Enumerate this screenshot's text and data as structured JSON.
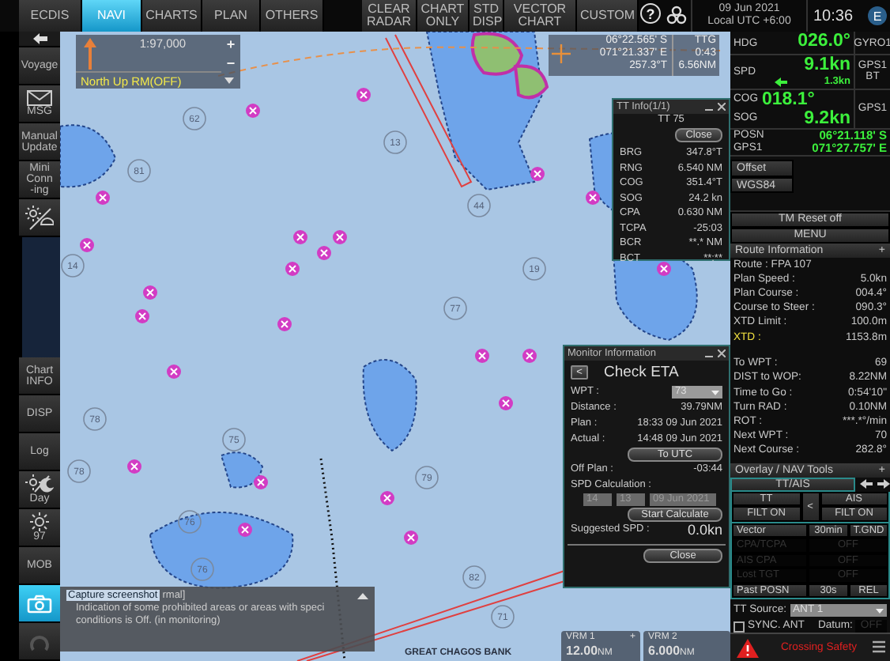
{
  "top_bar": {
    "tabs": [
      {
        "label": "ECDIS",
        "selected": false
      },
      {
        "label": "NAVI",
        "selected": true
      },
      {
        "label": "CHARTS",
        "selected": false
      },
      {
        "label": "PLAN",
        "selected": false
      },
      {
        "label": "OTHERS",
        "selected": false
      }
    ],
    "buttons": [
      "CLEAR RADAR",
      "CHART ONLY",
      "STD DISP",
      "VECTOR CHART",
      "CUSTOM"
    ],
    "help": "?",
    "date": "09 Jun 2021",
    "timezone": "Local UTC +6:00",
    "time": "10:36",
    "mode_badge": "E"
  },
  "sidebar": {
    "upper": [
      {
        "kind": "text",
        "label": "Voyage",
        "selected": false
      },
      {
        "kind": "mail",
        "label": "MSG",
        "selected": false
      },
      {
        "kind": "text",
        "label": "Manual\nUpdate",
        "selected": false
      },
      {
        "kind": "text",
        "label": "Mini\nConn\n-ing",
        "selected": false
      },
      {
        "kind": "daynight",
        "selected": false
      }
    ],
    "lower": [
      {
        "kind": "text",
        "label": "Chart\nINFO",
        "selected": false
      },
      {
        "kind": "text",
        "label": "DISP",
        "selected": false
      },
      {
        "kind": "text",
        "label": "Log",
        "selected": false
      },
      {
        "kind": "day",
        "label": "Day",
        "selected": false
      },
      {
        "kind": "brightness",
        "label": "97",
        "selected": false
      },
      {
        "kind": "text",
        "label": "MOB",
        "selected": false
      },
      {
        "kind": "camera",
        "selected": true
      },
      {
        "kind": "undo",
        "selected": false
      }
    ]
  },
  "chart": {
    "place_label": "GREAT CHAGOS BANK",
    "soundings": [
      "81",
      "13",
      "14",
      "62",
      "44",
      "78",
      "76",
      "75",
      "79",
      "77",
      "78",
      "76",
      "71",
      "19",
      "82"
    ]
  },
  "scale_box": {
    "scale": "1:97,000",
    "zoom_in": "+",
    "zoom_out": "−",
    "orientation": "North  Up RM(OFF)"
  },
  "cursor_info": {
    "lat": "06°22.565' S",
    "lon": "071°21.337' E",
    "bearing": "257.3°T",
    "ttg_label": "TTG",
    "ttg": "0:43",
    "range": "6.56NM"
  },
  "tt_info": {
    "title": "TT Info(1/1)",
    "target": "TT  75",
    "close": "Close",
    "rows": [
      {
        "label": "BRG",
        "value": "347.8°T"
      },
      {
        "label": "RNG",
        "value": "6.540 NM"
      },
      {
        "label": "COG",
        "value": "351.4°T"
      },
      {
        "label": "SOG",
        "value": "24.2 kn"
      },
      {
        "label": "CPA",
        "value": "0.630 NM"
      },
      {
        "label": "TCPA",
        "value": "-25:03"
      },
      {
        "label": "BCR",
        "value": "**.* NM"
      },
      {
        "label": "BCT",
        "value": "**:**"
      }
    ]
  },
  "monitor": {
    "title": "Monitor Information",
    "back": "<",
    "heading": "Check ETA",
    "wpt_label": "WPT :",
    "wpt": "73",
    "rows": [
      {
        "label": "Distance :",
        "value": "39.79NM"
      },
      {
        "label": "Plan :",
        "value": "18:33 09 Jun 2021"
      },
      {
        "label": "Actual :",
        "value": "14:48 09 Jun 2021"
      }
    ],
    "to_utc": "To UTC",
    "off_plan_label": "Off Plan :",
    "off_plan": "-03:44",
    "spd_calc_label": "SPD Calculation :",
    "spd_calc": {
      "disabled": true,
      "hour": "14",
      "minute": "13",
      "date": "09 Jun 2021"
    },
    "start": "Start Calculate",
    "suggested_label": "Suggested SPD :",
    "suggested": "0.0kn",
    "close": "Close"
  },
  "messages": {
    "tooltip": "Capture screenshot",
    "lines": [
      "rmal]",
      "Indication of some prohibited areas or areas with speci",
      "conditions is Off. (in monitoring)"
    ]
  },
  "vrm": [
    {
      "label": "VRM 1",
      "expand": "+",
      "value": "12.00",
      "unit": "NM"
    },
    {
      "label": "VRM 2",
      "value": "6.000",
      "unit": "NM"
    }
  ],
  "nav_data": {
    "hdg": {
      "label": "HDG",
      "value": "026.0°",
      "source": "GYRO1"
    },
    "spd": {
      "label": "SPD",
      "value": "9.1kn",
      "drift": "1.3kn",
      "source": "GPS1 BT"
    },
    "cog": {
      "label": "COG",
      "value": "018.1°"
    },
    "sog": {
      "label": "SOG",
      "value": "9.2kn"
    },
    "cog_sog_source": "GPS1",
    "posn": {
      "label": "POSN",
      "source": "GPS1",
      "lat": "06°21.118' S",
      "lon": "071°27.757' E"
    },
    "offset": "Offset",
    "datum": "WGS84",
    "tm_reset": "TM Reset off",
    "menu": "MENU"
  },
  "route_info": {
    "title": "Route Information",
    "expand": "+",
    "route": "Route : FPA 107",
    "rows": [
      {
        "label": "Plan Speed :",
        "value": "5.0kn",
        "highlight": false
      },
      {
        "label": "Plan Course :",
        "value": "004.4°",
        "highlight": false
      },
      {
        "label": "Course to Steer :",
        "value": "090.3°",
        "highlight": false
      },
      {
        "label": "XTD Limit :",
        "value": "100.0m",
        "highlight": false
      },
      {
        "label": "XTD :",
        "value": "1153.8m",
        "highlight": true
      }
    ],
    "wpt_rows": [
      {
        "label": "To WPT :",
        "value": "69"
      },
      {
        "label": "DIST to WOP:",
        "value": "8.22NM"
      },
      {
        "label": "Time to Go :",
        "value": "0:54'10\""
      },
      {
        "label": "Turn RAD :",
        "value": "0.10NM"
      },
      {
        "label": "ROT :",
        "value": "***.*°/min"
      },
      {
        "label": "Next WPT :",
        "value": "70"
      },
      {
        "label": "Next Course :",
        "value": "282.8°"
      }
    ]
  },
  "overlay_tools": {
    "title": "Overlay / NAV Tools",
    "expand": "+",
    "tab": "TT/AIS",
    "tt": "TT",
    "swap": "<",
    "ais": "AIS",
    "tt_filter": "FILT ON",
    "ais_filter": "FILT ON",
    "rows": [
      {
        "label": "Vector",
        "value": "30min",
        "mode": "T.GND",
        "disabled": false
      },
      {
        "label": "CPA/TCPA",
        "value": "OFF",
        "disabled": true
      },
      {
        "label": "AIS CPA",
        "value": "OFF",
        "disabled": true
      },
      {
        "label": "Lost TGT",
        "value": "OFF",
        "disabled": true
      },
      {
        "label": "Past POSN",
        "value": "30s",
        "mode": "REL",
        "disabled": false
      }
    ],
    "tt_source_label": "TT Source:",
    "tt_source": "ANT 1",
    "sync": {
      "label": "SYNC. ANT",
      "checked": false
    },
    "datum_label": "Datum:",
    "datum_value": "OFF"
  },
  "alert": {
    "text": "Crossing Safety"
  }
}
